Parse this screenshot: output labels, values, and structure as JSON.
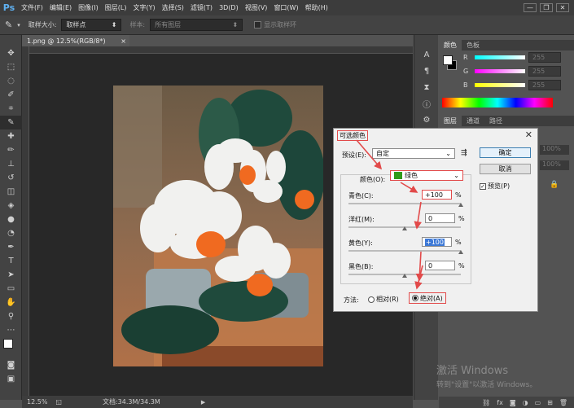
{
  "app": {
    "logo": "Ps"
  },
  "menu": [
    "文件(F)",
    "编辑(E)",
    "图像(I)",
    "图层(L)",
    "文字(Y)",
    "选择(S)",
    "滤镜(T)",
    "3D(D)",
    "视图(V)",
    "窗口(W)",
    "帮助(H)"
  ],
  "window_controls": [
    "—",
    "❐",
    "✕"
  ],
  "options_bar": {
    "sample_size_label": "取样大小:",
    "sample_size_value": "取样点",
    "sample_label": "样本:",
    "sample_value": "所有图层",
    "show_ring_label": "显示取样环"
  },
  "document": {
    "tab_title": "1.png @ 12.5%(RGB/8*)",
    "tab_close": "×",
    "zoom": "12.5%",
    "doc_size": "文档:34.3M/34.3M"
  },
  "color_panel": {
    "tabs": [
      "颜色",
      "色板"
    ],
    "channels": [
      {
        "label": "R",
        "value": "255"
      },
      {
        "label": "G",
        "value": "255"
      },
      {
        "label": "B",
        "value": "255"
      }
    ]
  },
  "layers_panel": {
    "tabs": [
      "图层",
      "通道",
      "路径"
    ],
    "opacity": "100%",
    "fill": "100%"
  },
  "dialog": {
    "title": "可选颜色",
    "close": "✕",
    "preset_label": "预设(E):",
    "preset_value": "自定",
    "ok_label": "确定",
    "cancel_label": "取消",
    "preview_label": "预览(P)",
    "preview_checked": true,
    "color_label": "颜色(O):",
    "color_value": "绿色",
    "color_swatch": "#2f9b1a",
    "sliders": [
      {
        "label": "青色(C):",
        "value": "+100",
        "unit": "%",
        "level": 1.0
      },
      {
        "label": "洋红(M):",
        "value": "0",
        "unit": "%",
        "level": 0.5
      },
      {
        "label": "黄色(Y):",
        "value": "+100",
        "unit": "%",
        "level": 1.0
      },
      {
        "label": "黑色(B):",
        "value": "0",
        "unit": "%",
        "level": 0.5
      }
    ],
    "method_label": "方法:",
    "relative_label": "相对(R)",
    "absolute_label": "绝对(A)",
    "method_selected": "absolute"
  },
  "watermark": {
    "line1": "激活 Windows",
    "line2": "转到\"设置\"以激活 Windows。"
  },
  "colors": {
    "highlight_red": "#e24a4a",
    "canvas_bg": "#282828",
    "panel_bg": "#535353"
  }
}
